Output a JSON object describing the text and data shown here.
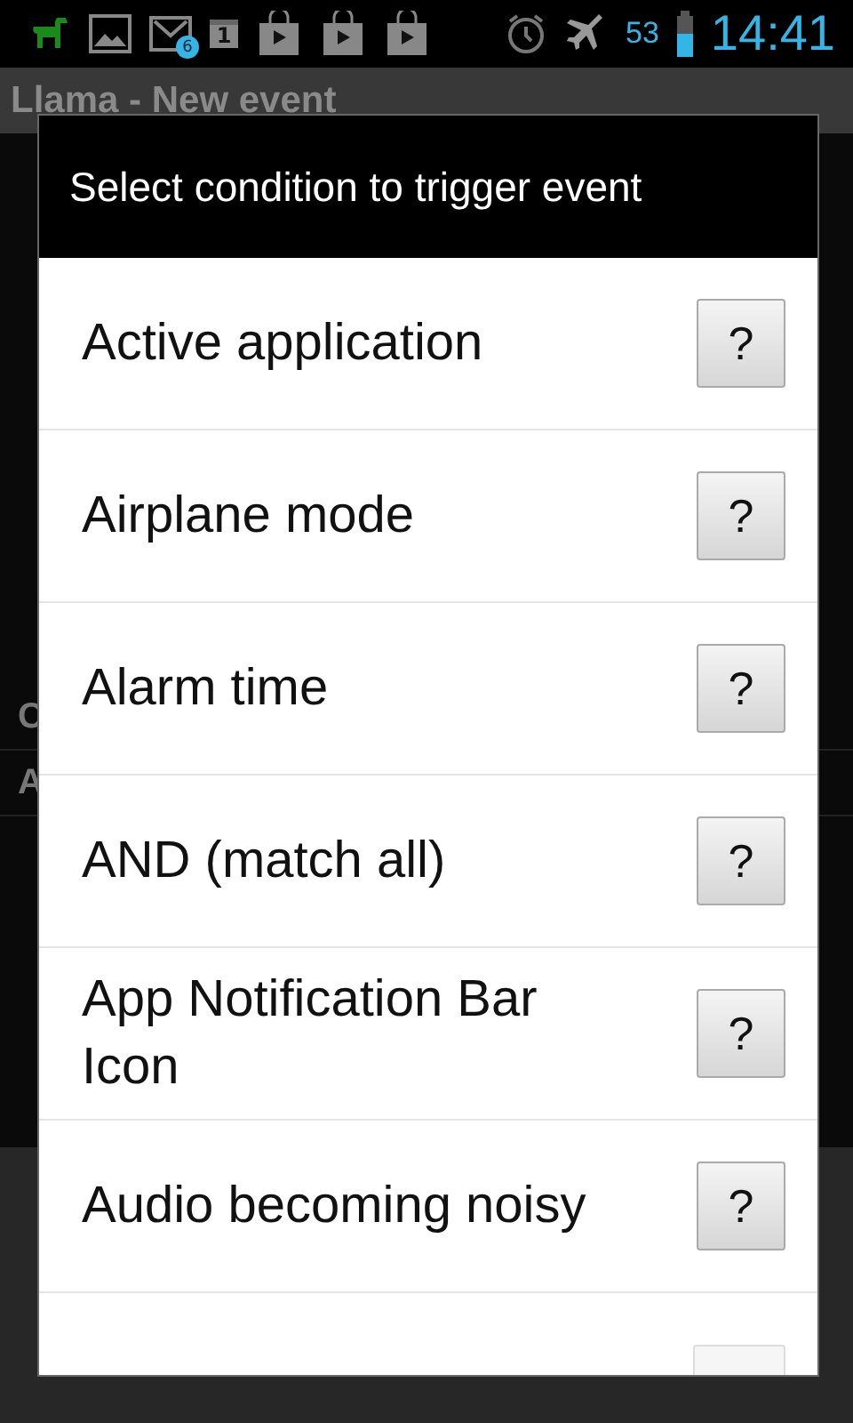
{
  "status_bar": {
    "mail_badge": "6",
    "calendar_day": "1",
    "battery_percent": "53",
    "time": "14:41"
  },
  "app": {
    "title": "Llama - New event",
    "rows": [
      "C",
      "A"
    ]
  },
  "dialog": {
    "title": "Select condition to trigger event",
    "items": [
      {
        "label": "Active application",
        "help": "?"
      },
      {
        "label": "Airplane mode",
        "help": "?"
      },
      {
        "label": "Alarm time",
        "help": "?"
      },
      {
        "label": "AND (match all)",
        "help": "?"
      },
      {
        "label": "App Notification Bar Icon",
        "help": "?"
      },
      {
        "label": "Audio becoming noisy",
        "help": "?"
      }
    ]
  }
}
